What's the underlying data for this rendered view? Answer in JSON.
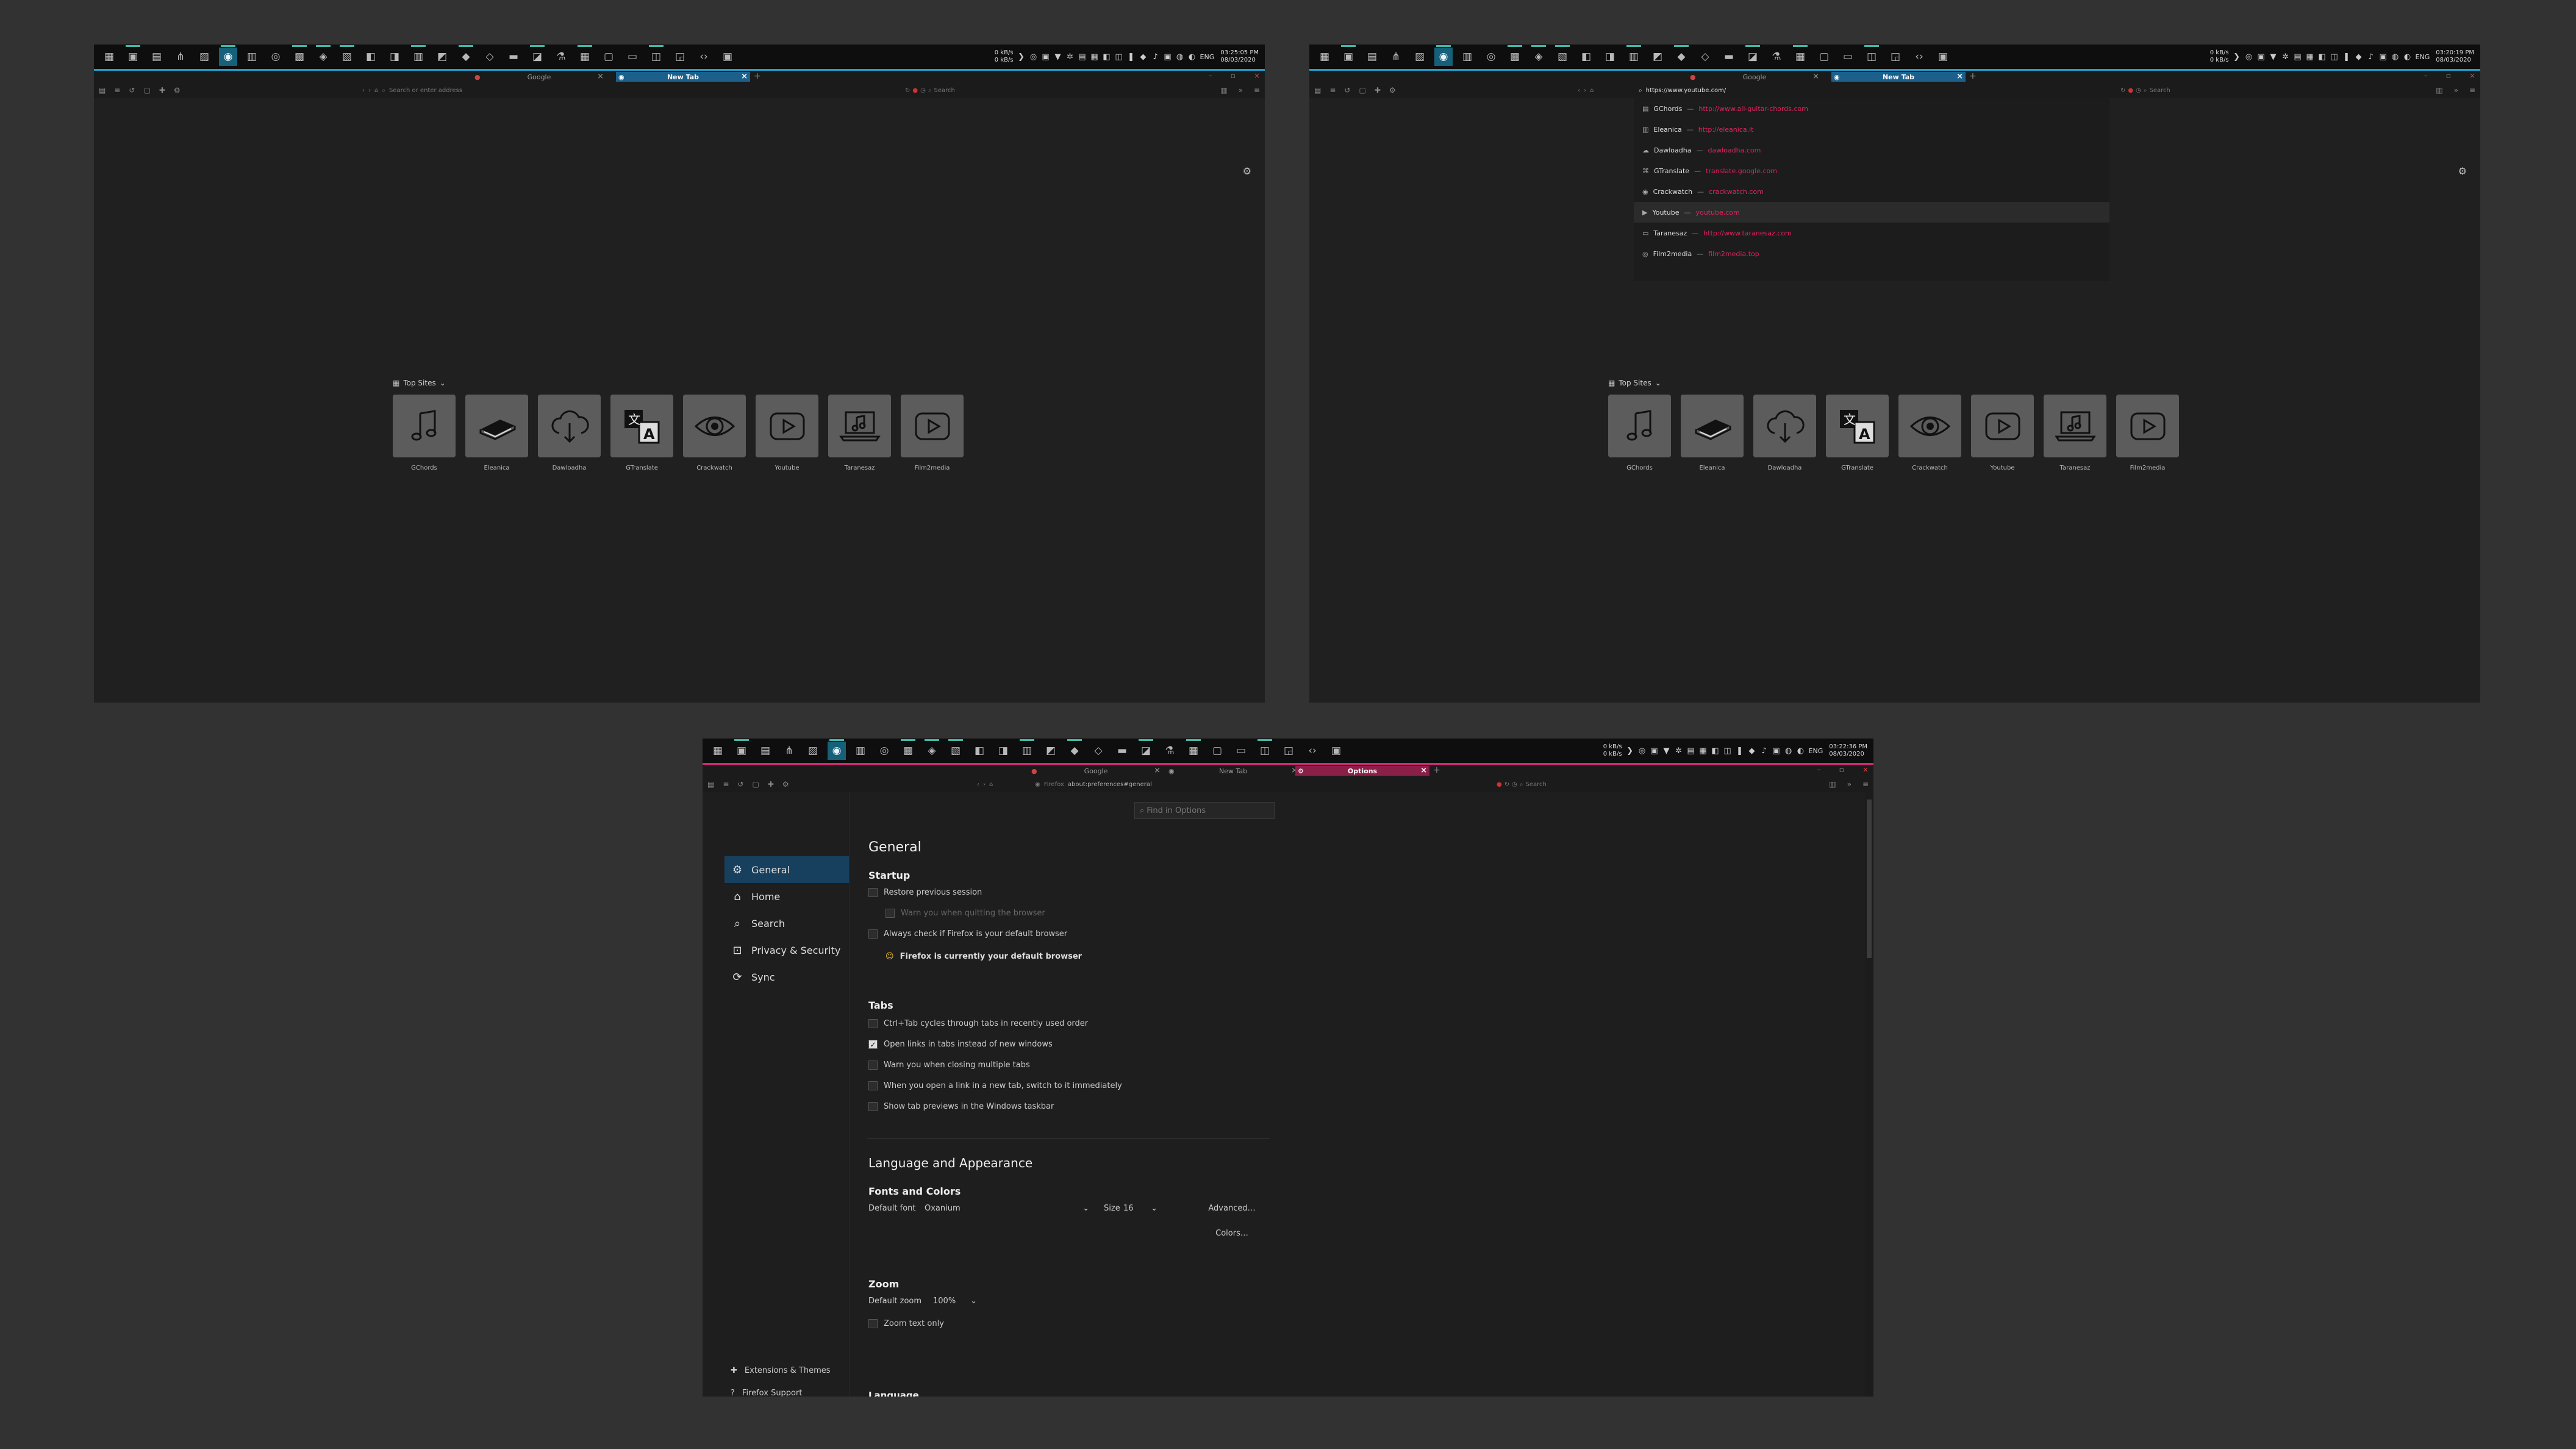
{
  "windows": [
    {
      "tabs": [
        {
          "label": "Google",
          "selected": false
        },
        {
          "label": "New Tab",
          "selected": true
        }
      ],
      "url_placeholder": "Search or enter address",
      "url_value": "",
      "search_placeholder": "Search",
      "taskbar": {
        "net_up": "0 kB/s",
        "net_down": "0 kB/s",
        "lang": "ENG",
        "time": "03:25:05 PM",
        "date": "08/03/2020"
      }
    },
    {
      "tabs": [
        {
          "label": "Google",
          "selected": false
        },
        {
          "label": "New Tab",
          "selected": true
        }
      ],
      "url_value": "https://www.youtube.com/",
      "search_placeholder": "Search",
      "taskbar": {
        "net_up": "0 kB/s",
        "net_down": "0 kB/s",
        "lang": "ENG",
        "time": "03:20:19 PM",
        "date": "08/03/2020"
      },
      "dropdown": [
        {
          "title": "GChords",
          "url": "http://www.all-guitar-chords.com"
        },
        {
          "title": "Eleanica",
          "url": "http://eleanica.it"
        },
        {
          "title": "Dawloadha",
          "url": "dawloadha.com"
        },
        {
          "title": "GTranslate",
          "url": "translate.google.com"
        },
        {
          "title": "Crackwatch",
          "url": "crackwatch.com"
        },
        {
          "title": "Youtube",
          "url": "youtube.com"
        },
        {
          "title": "Taranesaz",
          "url": "http://www.taranesaz.com"
        },
        {
          "title": "Film2media",
          "url": "film2media.top"
        }
      ]
    },
    {
      "tabs": [
        {
          "label": "Google",
          "selected": false
        },
        {
          "label": "New Tab",
          "selected": false
        },
        {
          "label": "Options",
          "selected": true
        }
      ],
      "url_prefix": "Firefox",
      "url_value": "about:preferences#general",
      "search_placeholder": "Search",
      "taskbar": {
        "net_up": "0 kB/s",
        "net_down": "0 kB/s",
        "lang": "ENG",
        "time": "03:22:36 PM",
        "date": "08/03/2020"
      }
    }
  ],
  "top_sites": {
    "heading": "Top Sites",
    "sites": [
      {
        "name": "GChords",
        "icon": "music-note-icon"
      },
      {
        "name": "Eleanica",
        "icon": "book-icon"
      },
      {
        "name": "Dawloadha",
        "icon": "cloud-download-icon"
      },
      {
        "name": "GTranslate",
        "icon": "translate-icon"
      },
      {
        "name": "Crackwatch",
        "icon": "eye-icon"
      },
      {
        "name": "Youtube",
        "icon": "play-icon"
      },
      {
        "name": "Taranesaz",
        "icon": "laptop-music-icon"
      },
      {
        "name": "Film2media",
        "icon": "play-icon"
      }
    ]
  },
  "options": {
    "find_placeholder": "Find in Options",
    "nav": [
      {
        "label": "General",
        "icon": "gear-icon",
        "selected": true
      },
      {
        "label": "Home",
        "icon": "home-icon",
        "selected": false
      },
      {
        "label": "Search",
        "icon": "search-icon",
        "selected": false
      },
      {
        "label": "Privacy & Security",
        "icon": "lock-icon",
        "selected": false
      },
      {
        "label": "Sync",
        "icon": "sync-icon",
        "selected": false
      }
    ],
    "footer": [
      {
        "label": "Extensions & Themes",
        "icon": "puzzle-icon"
      },
      {
        "label": "Firefox Support",
        "icon": "help-icon"
      }
    ],
    "general_title": "General",
    "startup": {
      "title": "Startup",
      "items": [
        {
          "label": "Restore previous session",
          "checked": false,
          "disabled": false
        },
        {
          "label": "Warn you when quitting the browser",
          "checked": false,
          "disabled": true
        },
        {
          "label": "Always check if Firefox is your default browser",
          "checked": false,
          "disabled": false
        }
      ],
      "default_msg": "Firefox is currently your default browser"
    },
    "tabs": {
      "title": "Tabs",
      "items": [
        {
          "label": "Ctrl+Tab cycles through tabs in recently used order",
          "checked": false
        },
        {
          "label": "Open links in tabs instead of new windows",
          "checked": true
        },
        {
          "label": "Warn you when closing multiple tabs",
          "checked": false
        },
        {
          "label": "When you open a link in a new tab, switch to it immediately",
          "checked": false
        },
        {
          "label": "Show tab previews in the Windows taskbar",
          "checked": false
        }
      ]
    },
    "lang_title": "Language and Appearance",
    "fonts": {
      "title": "Fonts and Colors",
      "default_font_label": "Default font",
      "default_font_value": "Oxanium",
      "size_label": "Size",
      "size_value": "16",
      "advanced_btn": "Advanced…",
      "colors_btn": "Colors…"
    },
    "zoom": {
      "title": "Zoom",
      "default_zoom_label": "Default zoom",
      "default_zoom_value": "100%",
      "text_only_label": "Zoom text only",
      "text_only_checked": false
    },
    "language_title": "Language"
  }
}
